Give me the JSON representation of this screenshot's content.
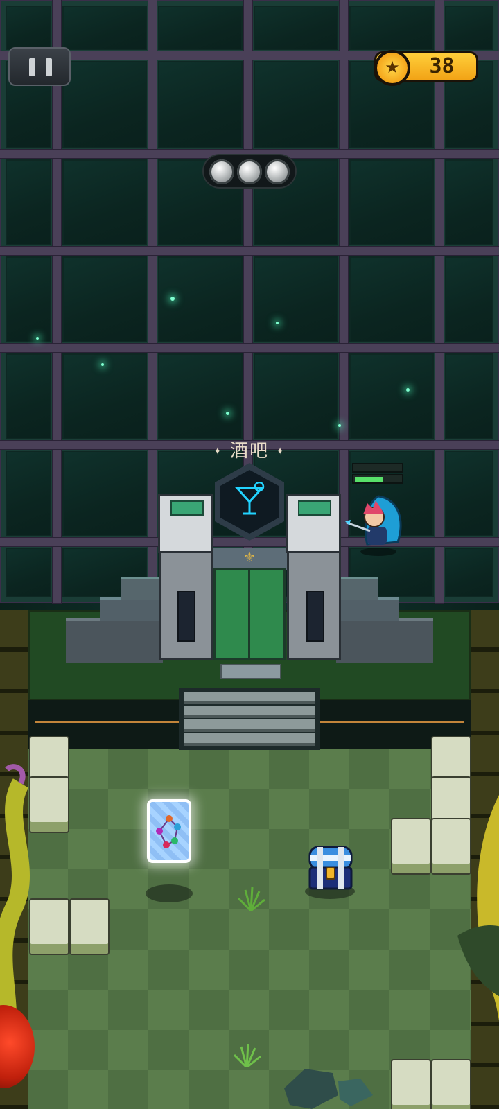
{
  "hud": {
    "pause_icon": "pause-icon",
    "coin_icon": "star-coin-icon",
    "coins": "38",
    "orbs": [
      {
        "state": "empty"
      },
      {
        "state": "empty"
      },
      {
        "state": "empty"
      }
    ]
  },
  "building": {
    "label_left_ornament": "✦",
    "label": "酒吧",
    "label_right_ornament": "✦",
    "icon": "cocktail-icon"
  },
  "player": {
    "health_fraction": 0.6,
    "icon": "hero-character"
  },
  "items": {
    "card_icon": "constellation-card-icon",
    "chest_icon": "treasure-chest-icon"
  },
  "colors": {
    "accent_coin": "#f4b51e",
    "health": "#58e06a",
    "bar_icon": "#22d3ff"
  }
}
